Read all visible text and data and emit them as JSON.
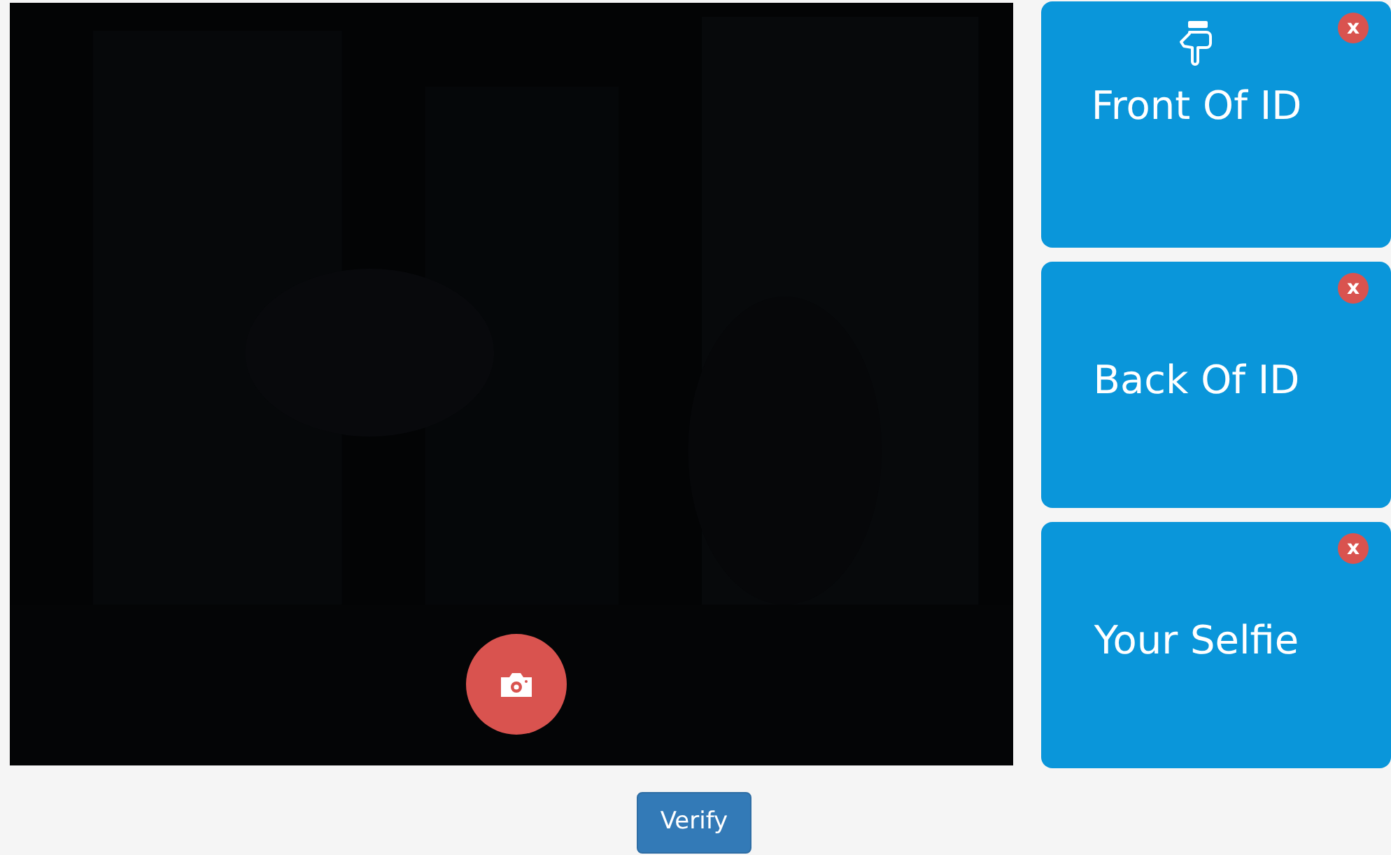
{
  "camera": {
    "kind": "picture",
    "capture_button": true
  },
  "cards": [
    {
      "label": "Front Of ID",
      "pointer": true,
      "close": "x"
    },
    {
      "label": "Back Of ID",
      "pointer": false,
      "close": "x"
    },
    {
      "label": "Your Selfie",
      "pointer": false,
      "close": "x"
    }
  ],
  "verify_button": "Verify"
}
